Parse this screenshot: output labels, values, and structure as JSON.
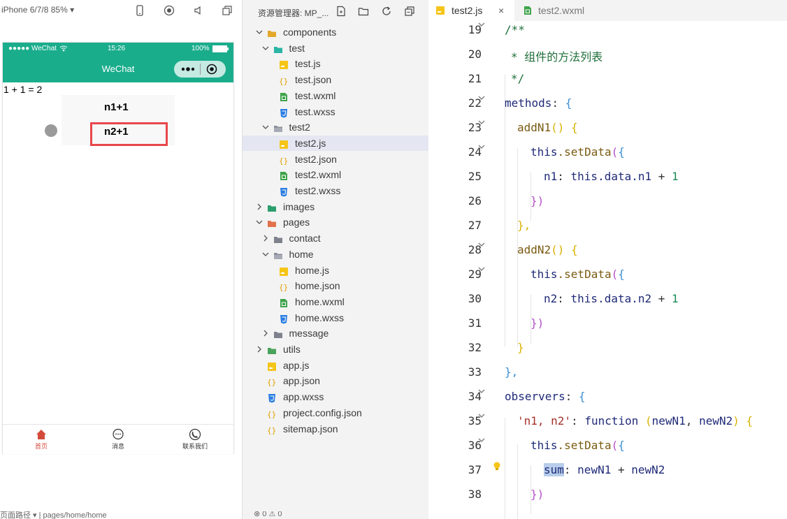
{
  "simulator": {
    "device": "iPhone 6/7/8 85% ▾",
    "status": {
      "carrier": "●●●●● WeChat",
      "time": "15:26",
      "battery": "100%"
    },
    "nav_title": "WeChat",
    "sum_text": "1 + 1 = 2",
    "buttons": [
      "n1+1",
      "n2+1"
    ],
    "tabs": [
      {
        "label": "首页",
        "icon": "home-icon"
      },
      {
        "label": "消息",
        "icon": "message-icon"
      },
      {
        "label": "联系我们",
        "icon": "phone-icon"
      }
    ],
    "bottom_path": "页面路径 ▾  |  pages/home/home"
  },
  "explorer": {
    "title": "资源管理器: MP_...",
    "bottom": "⊗ 0 ⚠ 0",
    "tree": [
      {
        "label": "components",
        "type": "folder",
        "open": true
      },
      {
        "label": "test",
        "type": "folder",
        "open": true
      },
      {
        "label": "test.js",
        "type": "js"
      },
      {
        "label": "test.json",
        "type": "json"
      },
      {
        "label": "test.wxml",
        "type": "wxml"
      },
      {
        "label": "test.wxss",
        "type": "wxss"
      },
      {
        "label": "test2",
        "type": "folder",
        "open": true
      },
      {
        "label": "test2.js",
        "type": "js",
        "selected": true
      },
      {
        "label": "test2.json",
        "type": "json"
      },
      {
        "label": "test2.wxml",
        "type": "wxml"
      },
      {
        "label": "test2.wxss",
        "type": "wxss"
      },
      {
        "label": "images",
        "type": "folder",
        "open": false
      },
      {
        "label": "pages",
        "type": "folder",
        "open": true
      },
      {
        "label": "contact",
        "type": "folder",
        "open": false
      },
      {
        "label": "home",
        "type": "folder",
        "open": true
      },
      {
        "label": "home.js",
        "type": "js"
      },
      {
        "label": "home.json",
        "type": "json"
      },
      {
        "label": "home.wxml",
        "type": "wxml"
      },
      {
        "label": "home.wxss",
        "type": "wxss"
      },
      {
        "label": "message",
        "type": "folder",
        "open": false
      },
      {
        "label": "utils",
        "type": "folder",
        "open": false
      },
      {
        "label": "app.js",
        "type": "js"
      },
      {
        "label": "app.json",
        "type": "json"
      },
      {
        "label": "app.wxss",
        "type": "wxss"
      },
      {
        "label": "project.config.json",
        "type": "json"
      },
      {
        "label": "sitemap.json",
        "type": "json"
      }
    ]
  },
  "editor": {
    "tabs": [
      {
        "label": "test2.js",
        "active": true,
        "close": "×"
      },
      {
        "label": "test2.wxml",
        "active": false
      }
    ],
    "line_numbers": [
      "19",
      "20",
      "21",
      "22",
      "23",
      "24",
      "25",
      "26",
      "27",
      "28",
      "29",
      "30",
      "31",
      "32",
      "33",
      "34",
      "35",
      "36",
      "37",
      "38"
    ],
    "code": {
      "l19": "/**",
      "l20": "* 组件的方法列表",
      "l21": "*/",
      "l22_a": "methods",
      "l22_b": ": ",
      "l22_c": "{",
      "l23_a": "addN1",
      "l23_b": "()",
      "l23_c": " {",
      "l24_a": "this",
      "l24_b": ".setData",
      "l24_c": "(",
      "l24_d": "{",
      "l25_a": "n1",
      "l25_b": ": ",
      "l25_c": "this",
      "l25_d": ".data.n1",
      "l25_e": " + ",
      "l25_f": "1",
      "l26": "})",
      "l27": "},",
      "l28_a": "addN2",
      "l28_b": "()",
      "l28_c": " {",
      "l29_a": "this",
      "l29_b": ".setData",
      "l29_c": "(",
      "l29_d": "{",
      "l30_a": "n2",
      "l30_b": ": ",
      "l30_c": "this",
      "l30_d": ".data.n2",
      "l30_e": " + ",
      "l30_f": "1",
      "l31": "})",
      "l32": "}",
      "l33": "},",
      "l34_a": "observers",
      "l34_b": ": ",
      "l34_c": "{",
      "l35_a": "'n1, n2'",
      "l35_b": ": ",
      "l35_c": "function",
      "l35_d": " (",
      "l35_e": "newN1",
      "l35_f": ", ",
      "l35_g": "newN2",
      "l35_h": ")",
      "l35_i": " {",
      "l36_a": "this",
      "l36_b": ".setData",
      "l36_c": "(",
      "l36_d": "{",
      "l37_a": "sum",
      "l37_b": ": ",
      "l37_c": "newN1",
      "l37_d": " + ",
      "l37_e": "newN2",
      "l38": "})"
    },
    "colors": {
      "accent": "#1aad8c",
      "highlight_border": "#e8474b",
      "selected_row": "#e4e6f1"
    }
  }
}
